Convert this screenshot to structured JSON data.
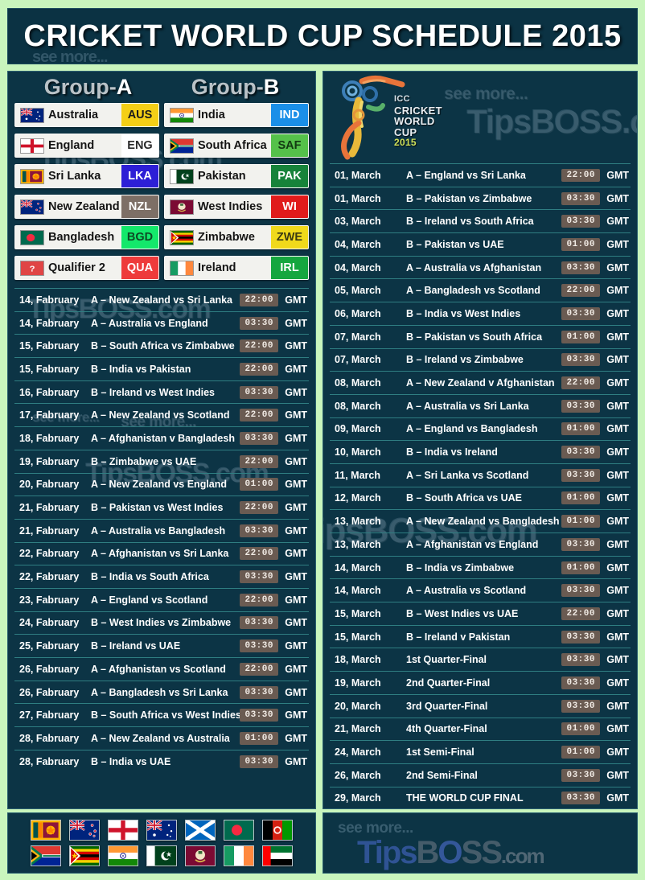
{
  "header": {
    "title": "CRICKET WORLD CUP SCHEDULE 2015",
    "watermark_see": "see more...",
    "watermark_site": "TipsBOSS.com"
  },
  "logo": {
    "icc": "ICC",
    "line1": "CRICKET",
    "line2": "WORLD",
    "line3": "CUP",
    "year": "2015",
    "see_more": "see more...",
    "site_tips": "Tips",
    "site_b": "B",
    "site_o": "O",
    "site_ss": "SS",
    "site_com": ".com"
  },
  "groups": [
    {
      "label_prefix": "Group-",
      "label_letter": "A",
      "teams": [
        {
          "name": "Australia",
          "abbr": "AUS",
          "abbr_bg": "#f4cf16",
          "abbr_fg": "#1b1b1b",
          "flag": "australia"
        },
        {
          "name": "England",
          "abbr": "ENG",
          "abbr_bg": "#ffffff",
          "abbr_fg": "#2a2a2a",
          "flag": "england"
        },
        {
          "name": "Sri Lanka",
          "abbr": "LKA",
          "abbr_bg": "#2d1fd6",
          "abbr_fg": "#ffffff",
          "flag": "srilanka"
        },
        {
          "name": "New Zealand",
          "abbr": "NZL",
          "abbr_bg": "#7d6f66",
          "abbr_fg": "#ffffff",
          "flag": "newzealand"
        },
        {
          "name": "Bangladesh",
          "abbr": "BGD",
          "abbr_bg": "#13e86b",
          "abbr_fg": "#0d4a25",
          "flag": "bangladesh"
        },
        {
          "name": "Qualifier 2",
          "abbr": "QUA",
          "abbr_bg": "#ee3b3b",
          "abbr_fg": "#ffffff",
          "flag": "qualifier"
        }
      ]
    },
    {
      "label_prefix": "Group-",
      "label_letter": "B",
      "teams": [
        {
          "name": "India",
          "abbr": "IND",
          "abbr_bg": "#1a8fe8",
          "abbr_fg": "#ffffff",
          "flag": "india"
        },
        {
          "name": "South Africa",
          "abbr": "SAF",
          "abbr_bg": "#55c14a",
          "abbr_fg": "#123a12",
          "flag": "southafrica"
        },
        {
          "name": "Pakistan",
          "abbr": "PAK",
          "abbr_bg": "#17833a",
          "abbr_fg": "#ffffff",
          "flag": "pakistan"
        },
        {
          "name": "West Indies",
          "abbr": "WI",
          "abbr_bg": "#e01b1b",
          "abbr_fg": "#ffffff",
          "flag": "westindies"
        },
        {
          "name": "Zimbabwe",
          "abbr": "ZWE",
          "abbr_bg": "#f0d91b",
          "abbr_fg": "#3a3a12",
          "flag": "zimbabwe"
        },
        {
          "name": "Ireland",
          "abbr": "IRL",
          "abbr_bg": "#15a63f",
          "abbr_fg": "#ffffff",
          "flag": "ireland"
        }
      ]
    }
  ],
  "schedule_left": [
    {
      "date": "14, Fabruary",
      "match": "A – New Zealand vs Sri Lanka",
      "time": "22:00",
      "tz": "GMT"
    },
    {
      "date": "14, Fabruary",
      "match": "A – Australia vs England",
      "time": "03:30",
      "tz": "GMT"
    },
    {
      "date": "15, Fabruary",
      "match": "B – South Africa vs Zimbabwe",
      "time": "22:00",
      "tz": "GMT"
    },
    {
      "date": "15, Fabruary",
      "match": "B – India vs Pakistan",
      "time": "22:00",
      "tz": "GMT"
    },
    {
      "date": "16, Fabruary",
      "match": "B – Ireland vs West Indies",
      "time": "03:30",
      "tz": "GMT"
    },
    {
      "date": "17, Fabruary",
      "match": "A – New Zealand vs Scotland",
      "time": "22:00",
      "tz": "GMT"
    },
    {
      "date": "18, Fabruary",
      "match": "A – Afghanistan v Bangladesh",
      "time": "03:30",
      "tz": "GMT"
    },
    {
      "date": "19, Fabruary",
      "match": "B – Zimbabwe vs UAE",
      "time": "22:00",
      "tz": "GMT"
    },
    {
      "date": "20, Fabruary",
      "match": "A – New Zealand vs England",
      "time": "01:00",
      "tz": "GMT"
    },
    {
      "date": "21, Fabruary",
      "match": "B – Pakistan vs West Indies",
      "time": "22:00",
      "tz": "GMT"
    },
    {
      "date": "21, Fabruary",
      "match": "A – Australia vs Bangladesh",
      "time": "03:30",
      "tz": "GMT"
    },
    {
      "date": "22, Fabruary",
      "match": "A – Afghanistan vs Sri Lanka",
      "time": "22:00",
      "tz": "GMT"
    },
    {
      "date": "22, Fabruary",
      "match": "B – India vs South Africa",
      "time": "03:30",
      "tz": "GMT"
    },
    {
      "date": "23, Fabruary",
      "match": "A – England vs Scotland",
      "time": "22:00",
      "tz": "GMT"
    },
    {
      "date": "24, Fabruary",
      "match": "B – West Indies vs Zimbabwe",
      "time": "03:30",
      "tz": "GMT"
    },
    {
      "date": "25, Fabruary",
      "match": "B – Ireland vs UAE",
      "time": "03:30",
      "tz": "GMT"
    },
    {
      "date": "26, Fabruary",
      "match": "A – Afghanistan vs Scotland",
      "time": "22:00",
      "tz": "GMT"
    },
    {
      "date": "26, Fabruary",
      "match": "A – Bangladesh vs Sri Lanka",
      "time": "03:30",
      "tz": "GMT"
    },
    {
      "date": "27, Fabruary",
      "match": "B – South Africa vs West Indies",
      "time": "03:30",
      "tz": "GMT"
    },
    {
      "date": "28, Fabruary",
      "match": "A – New Zealand vs Australia",
      "time": "01:00",
      "tz": "GMT"
    },
    {
      "date": "28, Fabruary",
      "match": "B – India vs UAE",
      "time": "03:30",
      "tz": "GMT"
    }
  ],
  "schedule_right": [
    {
      "date": "01, March",
      "match": "A – England vs Sri Lanka",
      "time": "22:00",
      "tz": "GMT"
    },
    {
      "date": "01, March",
      "match": "B – Pakistan vs Zimbabwe",
      "time": "03:30",
      "tz": "GMT"
    },
    {
      "date": "03, March",
      "match": "B – Ireland vs South Africa",
      "time": "03:30",
      "tz": "GMT"
    },
    {
      "date": "04, March",
      "match": "B – Pakistan vs UAE",
      "time": "01:00",
      "tz": "GMT"
    },
    {
      "date": "04, March",
      "match": "A – Australia vs Afghanistan",
      "time": "03:30",
      "tz": "GMT"
    },
    {
      "date": "05, March",
      "match": "A – Bangladesh vs Scotland",
      "time": "22:00",
      "tz": "GMT"
    },
    {
      "date": "06, March",
      "match": "B – India vs West Indies",
      "time": "03:30",
      "tz": "GMT"
    },
    {
      "date": "07, March",
      "match": "B – Pakistan vs South Africa",
      "time": "01:00",
      "tz": "GMT"
    },
    {
      "date": "07, March",
      "match": "B – Ireland vs Zimbabwe",
      "time": "03:30",
      "tz": "GMT"
    },
    {
      "date": "08, March",
      "match": "A – New Zealand v Afghanistan",
      "time": "22:00",
      "tz": "GMT"
    },
    {
      "date": "08, March",
      "match": "A – Australia vs Sri Lanka",
      "time": "03:30",
      "tz": "GMT"
    },
    {
      "date": "09, March",
      "match": "A – England vs Bangladesh",
      "time": "01:00",
      "tz": "GMT"
    },
    {
      "date": "10, March",
      "match": "B – India vs Ireland",
      "time": "03:30",
      "tz": "GMT"
    },
    {
      "date": "11, March",
      "match": "A – Sri Lanka vs Scotland",
      "time": "03:30",
      "tz": "GMT"
    },
    {
      "date": "12, March",
      "match": "B – South Africa vs UAE",
      "time": "01:00",
      "tz": "GMT"
    },
    {
      "date": "13, March",
      "match": "A – New Zealand vs Bangladesh",
      "time": "01:00",
      "tz": "GMT"
    },
    {
      "date": "13, March",
      "match": "A – Afghanistan vs England",
      "time": "03:30",
      "tz": "GMT"
    },
    {
      "date": "14, March",
      "match": "B – India vs Zimbabwe",
      "time": "01:00",
      "tz": "GMT"
    },
    {
      "date": "14, March",
      "match": "A – Australia vs Scotland",
      "time": "03:30",
      "tz": "GMT"
    },
    {
      "date": "15, March",
      "match": "B – West Indies vs UAE",
      "time": "22:00",
      "tz": "GMT"
    },
    {
      "date": "15, March",
      "match": "B – Ireland v Pakistan",
      "time": "03:30",
      "tz": "GMT"
    },
    {
      "date": "18, March",
      "match": "1st Quarter-Final",
      "time": "03:30",
      "tz": "GMT"
    },
    {
      "date": "19, March",
      "match": "2nd Quarter-Final",
      "time": "03:30",
      "tz": "GMT"
    },
    {
      "date": "20, March",
      "match": "3rd Quarter-Final",
      "time": "03:30",
      "tz": "GMT"
    },
    {
      "date": "21, March",
      "match": "4th Quarter-Final",
      "time": "01:00",
      "tz": "GMT"
    },
    {
      "date": "24, March",
      "match": "1st Semi-Final",
      "time": "01:00",
      "tz": "GMT"
    },
    {
      "date": "26, March",
      "match": "2nd Semi-Final",
      "time": "03:30",
      "tz": "GMT"
    },
    {
      "date": "29, March",
      "match": "THE WORLD CUP  FINAL",
      "time": "03:30",
      "tz": "GMT"
    }
  ],
  "flag_strip": [
    [
      "srilanka",
      "newzealand",
      "england",
      "australia",
      "scotland",
      "bangladesh",
      "afghanistan"
    ],
    [
      "southafrica",
      "zimbabwe",
      "india",
      "pakistan",
      "westindies",
      "ireland",
      "uae"
    ]
  ],
  "footer": {
    "see_more": "see more...",
    "tips": "Tips",
    "b": "B",
    "o": "O",
    "ss": "SS",
    "com": ".com"
  },
  "colors": {
    "page_border": "#c9f5bd",
    "panel_bg": "#0c3445",
    "title_bg": "#0b3243",
    "row_line": "#2f7e82",
    "time_badge": "#6a5b52"
  }
}
